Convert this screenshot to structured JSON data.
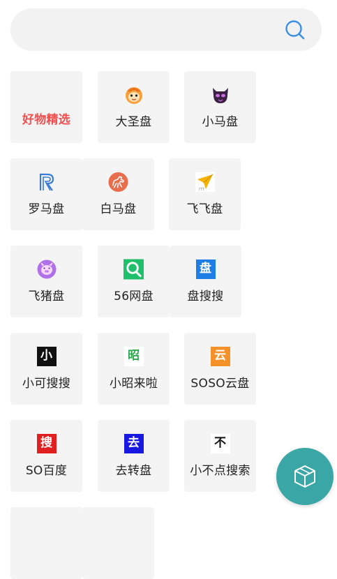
{
  "search": {
    "value": "",
    "placeholder": ""
  },
  "tiles": [
    {
      "label": "好物精选",
      "icon": "none",
      "accent": "#f05050"
    },
    {
      "label": "大圣盘",
      "icon": "monkey-king-icon",
      "accent": "#f7a13a"
    },
    {
      "label": "小马盘",
      "icon": "purple-devil-icon",
      "accent": "#3a2142"
    },
    {
      "label": "罗马盘",
      "icon": "r-logo-icon",
      "accent": "#3a7bd5"
    },
    {
      "label": "白马盘",
      "icon": "horse-icon",
      "accent": "#e86e4e"
    },
    {
      "label": "飞飞盘",
      "icon": "paper-plane-icon",
      "accent": "#f5b400"
    },
    {
      "label": "飞猪盘",
      "icon": "pig-icon",
      "accent": "#b070e8"
    },
    {
      "label": "56网盘",
      "icon": "magnifier-q-icon",
      "accent": "#1fbf6b"
    },
    {
      "label": "盘搜搜",
      "icon": "pan-char-icon",
      "accent": "#1e7ee6",
      "glyph": "盘"
    },
    {
      "label": "小可搜搜",
      "icon": "xiao-char-icon",
      "accent": "#111111",
      "glyph": "小"
    },
    {
      "label": "小昭来啦",
      "icon": "zhao-char-icon",
      "accent": "#2ea84f",
      "glyph": "昭"
    },
    {
      "label": "SOSO云盘",
      "icon": "yun-char-icon",
      "accent": "#f6912a",
      "glyph": "云"
    },
    {
      "label": "SO百度",
      "icon": "sou-char-icon",
      "accent": "#e02020",
      "glyph": "搜"
    },
    {
      "label": "去转盘",
      "icon": "qu-char-icon",
      "accent": "#1717e0",
      "glyph": "去"
    },
    {
      "label": "小不点搜索",
      "icon": "bu-char-icon",
      "accent": "#111111",
      "glyph": "不"
    }
  ],
  "colors": {
    "search_icon": "#3a8ee6",
    "fab": "#3aa6a6",
    "tile_bg": "#f4f4f4"
  },
  "fab": {
    "icon": "package-box-icon"
  }
}
